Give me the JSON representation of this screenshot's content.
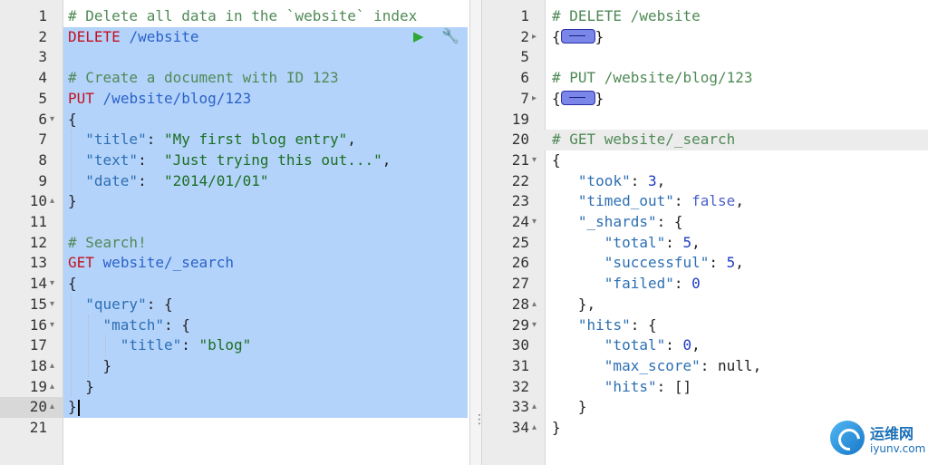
{
  "left_editor": {
    "lines": [
      {
        "num": "1",
        "fold": "",
        "tokens": [
          {
            "t": "cm",
            "v": "# Delete all data in the `website` index"
          }
        ]
      },
      {
        "num": "2",
        "fold": "",
        "tokens": [
          {
            "t": "kw",
            "v": "DELETE"
          },
          {
            "t": "pun",
            "v": " "
          },
          {
            "t": "url",
            "v": "/website"
          }
        ]
      },
      {
        "num": "3",
        "fold": "",
        "tokens": []
      },
      {
        "num": "4",
        "fold": "",
        "tokens": [
          {
            "t": "cm",
            "v": "# Create a document with ID 123"
          }
        ]
      },
      {
        "num": "5",
        "fold": "",
        "tokens": [
          {
            "t": "kw",
            "v": "PUT"
          },
          {
            "t": "pun",
            "v": " "
          },
          {
            "t": "url",
            "v": "/website/blog/123"
          }
        ]
      },
      {
        "num": "6",
        "fold": "▾",
        "tokens": [
          {
            "t": "pun",
            "v": "{"
          }
        ]
      },
      {
        "num": "7",
        "fold": "",
        "tokens": [
          {
            "t": "pun",
            "v": "  "
          },
          {
            "t": "key",
            "v": "\"title\""
          },
          {
            "t": "pun",
            "v": ": "
          },
          {
            "t": "str",
            "v": "\"My first blog entry\""
          },
          {
            "t": "pun",
            "v": ","
          }
        ]
      },
      {
        "num": "8",
        "fold": "",
        "tokens": [
          {
            "t": "pun",
            "v": "  "
          },
          {
            "t": "key",
            "v": "\"text\""
          },
          {
            "t": "pun",
            "v": ":  "
          },
          {
            "t": "str",
            "v": "\"Just trying this out...\""
          },
          {
            "t": "pun",
            "v": ","
          }
        ]
      },
      {
        "num": "9",
        "fold": "",
        "tokens": [
          {
            "t": "pun",
            "v": "  "
          },
          {
            "t": "key",
            "v": "\"date\""
          },
          {
            "t": "pun",
            "v": ":  "
          },
          {
            "t": "str",
            "v": "\"2014/01/01\""
          }
        ]
      },
      {
        "num": "10",
        "fold": "▴",
        "tokens": [
          {
            "t": "pun",
            "v": "}"
          }
        ]
      },
      {
        "num": "11",
        "fold": "",
        "tokens": []
      },
      {
        "num": "12",
        "fold": "",
        "tokens": [
          {
            "t": "cm",
            "v": "# Search!"
          }
        ]
      },
      {
        "num": "13",
        "fold": "",
        "tokens": [
          {
            "t": "kw",
            "v": "GET"
          },
          {
            "t": "pun",
            "v": " "
          },
          {
            "t": "url",
            "v": "website/_search"
          }
        ]
      },
      {
        "num": "14",
        "fold": "▾",
        "tokens": [
          {
            "t": "pun",
            "v": "{"
          }
        ]
      },
      {
        "num": "15",
        "fold": "▾",
        "tokens": [
          {
            "t": "pun",
            "v": "  "
          },
          {
            "t": "key",
            "v": "\"query\""
          },
          {
            "t": "pun",
            "v": ": {"
          }
        ]
      },
      {
        "num": "16",
        "fold": "▾",
        "tokens": [
          {
            "t": "pun",
            "v": "    "
          },
          {
            "t": "key",
            "v": "\"match\""
          },
          {
            "t": "pun",
            "v": ": {"
          }
        ]
      },
      {
        "num": "17",
        "fold": "",
        "tokens": [
          {
            "t": "pun",
            "v": "      "
          },
          {
            "t": "key",
            "v": "\"title\""
          },
          {
            "t": "pun",
            "v": ": "
          },
          {
            "t": "str",
            "v": "\"blog\""
          }
        ]
      },
      {
        "num": "18",
        "fold": "▴",
        "tokens": [
          {
            "t": "pun",
            "v": "    }"
          }
        ]
      },
      {
        "num": "19",
        "fold": "▴",
        "tokens": [
          {
            "t": "pun",
            "v": "  }"
          }
        ]
      },
      {
        "num": "20",
        "fold": "▴",
        "tokens": [
          {
            "t": "pun",
            "v": "}"
          }
        ],
        "cursor": true
      },
      {
        "num": "21",
        "fold": "",
        "tokens": []
      }
    ]
  },
  "right_editor": {
    "lines": [
      {
        "num": "1",
        "fold": "",
        "tokens": [
          {
            "t": "cm",
            "v": "# DELETE /website"
          }
        ]
      },
      {
        "num": "2",
        "fold": "▸",
        "tokens": [
          {
            "t": "pun",
            "v": "{"
          },
          {
            "t": "widget",
            "v": ""
          },
          {
            "t": "pun",
            "v": "}"
          }
        ]
      },
      {
        "num": "5",
        "fold": "",
        "tokens": []
      },
      {
        "num": "6",
        "fold": "",
        "tokens": [
          {
            "t": "cm",
            "v": "# PUT /website/blog/123"
          }
        ]
      },
      {
        "num": "7",
        "fold": "▸",
        "tokens": [
          {
            "t": "pun",
            "v": "{"
          },
          {
            "t": "widget",
            "v": ""
          },
          {
            "t": "pun",
            "v": "}"
          }
        ]
      },
      {
        "num": "19",
        "fold": "",
        "tokens": []
      },
      {
        "num": "20",
        "fold": "",
        "tokens": [
          {
            "t": "cm",
            "v": "# GET website/_search"
          }
        ],
        "active": true
      },
      {
        "num": "21",
        "fold": "▾",
        "tokens": [
          {
            "t": "pun",
            "v": "{"
          }
        ]
      },
      {
        "num": "22",
        "fold": "",
        "tokens": [
          {
            "t": "pun",
            "v": "   "
          },
          {
            "t": "key",
            "v": "\"took\""
          },
          {
            "t": "pun",
            "v": ": "
          },
          {
            "t": "num",
            "v": "3"
          },
          {
            "t": "pun",
            "v": ","
          }
        ]
      },
      {
        "num": "23",
        "fold": "",
        "tokens": [
          {
            "t": "pun",
            "v": "   "
          },
          {
            "t": "key",
            "v": "\"timed_out\""
          },
          {
            "t": "pun",
            "v": ": "
          },
          {
            "t": "bool",
            "v": "false"
          },
          {
            "t": "pun",
            "v": ","
          }
        ]
      },
      {
        "num": "24",
        "fold": "▾",
        "tokens": [
          {
            "t": "pun",
            "v": "   "
          },
          {
            "t": "key",
            "v": "\"_shards\""
          },
          {
            "t": "pun",
            "v": ": {"
          }
        ]
      },
      {
        "num": "25",
        "fold": "",
        "tokens": [
          {
            "t": "pun",
            "v": "      "
          },
          {
            "t": "key",
            "v": "\"total\""
          },
          {
            "t": "pun",
            "v": ": "
          },
          {
            "t": "num",
            "v": "5"
          },
          {
            "t": "pun",
            "v": ","
          }
        ]
      },
      {
        "num": "26",
        "fold": "",
        "tokens": [
          {
            "t": "pun",
            "v": "      "
          },
          {
            "t": "key",
            "v": "\"successful\""
          },
          {
            "t": "pun",
            "v": ": "
          },
          {
            "t": "num",
            "v": "5"
          },
          {
            "t": "pun",
            "v": ","
          }
        ]
      },
      {
        "num": "27",
        "fold": "",
        "tokens": [
          {
            "t": "pun",
            "v": "      "
          },
          {
            "t": "key",
            "v": "\"failed\""
          },
          {
            "t": "pun",
            "v": ": "
          },
          {
            "t": "num",
            "v": "0"
          }
        ]
      },
      {
        "num": "28",
        "fold": "▴",
        "tokens": [
          {
            "t": "pun",
            "v": "   },"
          }
        ]
      },
      {
        "num": "29",
        "fold": "▾",
        "tokens": [
          {
            "t": "pun",
            "v": "   "
          },
          {
            "t": "key",
            "v": "\"hits\""
          },
          {
            "t": "pun",
            "v": ": {"
          }
        ]
      },
      {
        "num": "30",
        "fold": "",
        "tokens": [
          {
            "t": "pun",
            "v": "      "
          },
          {
            "t": "key",
            "v": "\"total\""
          },
          {
            "t": "pun",
            "v": ": "
          },
          {
            "t": "num",
            "v": "0"
          },
          {
            "t": "pun",
            "v": ","
          }
        ]
      },
      {
        "num": "31",
        "fold": "",
        "tokens": [
          {
            "t": "pun",
            "v": "      "
          },
          {
            "t": "key",
            "v": "\"max_score\""
          },
          {
            "t": "pun",
            "v": ": null,"
          }
        ]
      },
      {
        "num": "32",
        "fold": "",
        "tokens": [
          {
            "t": "pun",
            "v": "      "
          },
          {
            "t": "key",
            "v": "\"hits\""
          },
          {
            "t": "pun",
            "v": ": []"
          }
        ]
      },
      {
        "num": "33",
        "fold": "▴",
        "tokens": [
          {
            "t": "pun",
            "v": "   }"
          }
        ]
      },
      {
        "num": "34",
        "fold": "▴",
        "tokens": [
          {
            "t": "pun",
            "v": "}"
          }
        ]
      }
    ]
  },
  "toolbar": {
    "run_icon": "play-icon",
    "wrench_icon": "wrench-icon"
  },
  "watermark": {
    "text_cn": "运维网",
    "text_url": "iyunv.com"
  },
  "colors": {
    "selection": "#b4d3fb",
    "keyword": "#c4111c",
    "comment": "#4f8a56",
    "url": "#2a62c9",
    "string": "#1c6f22",
    "number": "#1d3bc4",
    "run_green": "#2fa837"
  }
}
